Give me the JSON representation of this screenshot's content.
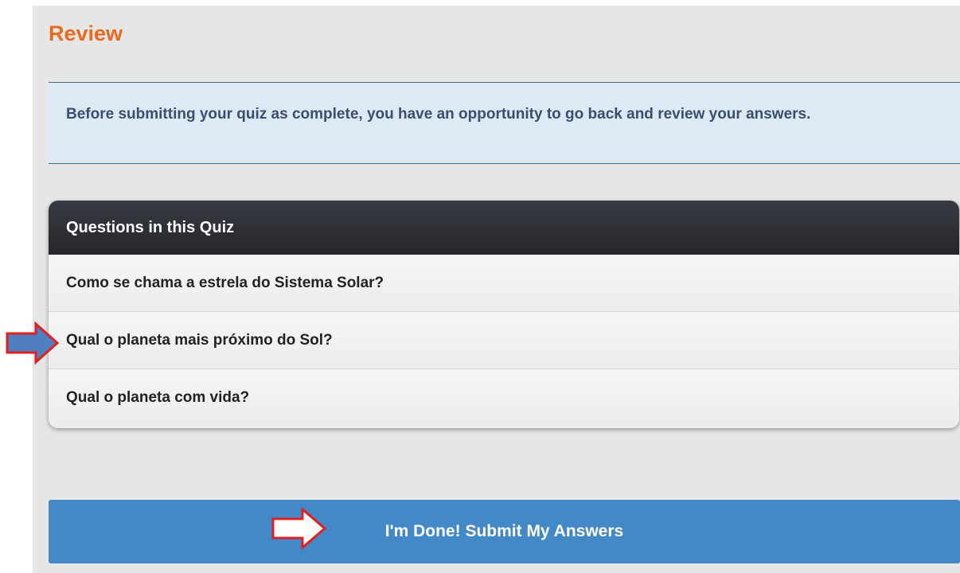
{
  "review": {
    "title": "Review",
    "notice": "Before submitting your quiz as complete, you have an opportunity to go back and review your answers."
  },
  "questions": {
    "header": "Questions in this Quiz",
    "items": [
      {
        "label": "Como se chama a estrela do Sistema Solar?"
      },
      {
        "label": "Qual o planeta mais próximo do Sol?"
      },
      {
        "label": "Qual o planeta com vida?"
      }
    ]
  },
  "submit": {
    "label": "I'm Done! Submit My Answers"
  },
  "annotations": {
    "arrow_question_color": "#4f7fc0",
    "arrow_submit_color": "#ffffff",
    "arrow_outline_color": "#e02020"
  }
}
